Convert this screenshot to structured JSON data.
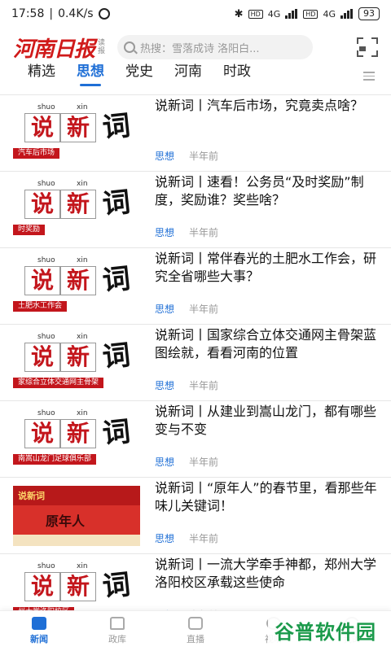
{
  "status": {
    "time": "17:58",
    "speed": "0.4K/s",
    "battery": "93",
    "net1": "4G",
    "net2": "4G",
    "hd": "HD"
  },
  "header": {
    "logo": "河南日报",
    "logo_sub": "读报",
    "search_placeholder": "热搜：雪落成诗 洛阳白..."
  },
  "tabs": [
    "精选",
    "思想",
    "党史",
    "河南",
    "时政"
  ],
  "active_tab": 1,
  "articles": [
    {
      "title": "说新词丨汽车后市场，究竟卖点啥？",
      "category": "思想",
      "time": "半年前",
      "ribbon": "汽车后市场",
      "py1": "shuo",
      "py2": "xin",
      "c1": "说",
      "c2": "新",
      "c3": "词"
    },
    {
      "title": "说新词丨速看！公务员“及时奖励”制度，奖励谁？奖些啥？",
      "category": "思想",
      "time": "半年前",
      "ribbon": "时奖励",
      "py1": "shuo",
      "py2": "xin",
      "c1": "说",
      "c2": "新",
      "c3": "词"
    },
    {
      "title": "说新词丨常伴春光的土肥水工作会，研究全省哪些大事？",
      "category": "思想",
      "time": "半年前",
      "ribbon": "土肥水工作会",
      "py1": "shuo",
      "py2": "xin",
      "c1": "说",
      "c2": "新",
      "c3": "词"
    },
    {
      "title": "说新词丨国家综合立体交通网主骨架蓝图绘就，看看河南的位置",
      "category": "思想",
      "time": "半年前",
      "ribbon": "家综合立体交通网主骨架",
      "py1": "shuo",
      "py2": "xin",
      "c1": "说",
      "c2": "新",
      "c3": "词"
    },
    {
      "title": "说新词丨从建业到嵩山龙门，都有哪些变与不变",
      "category": "思想",
      "time": "半年前",
      "ribbon": "南嵩山龙门足球俱乐部",
      "py1": "shuo",
      "py2": "xin",
      "c1": "说",
      "c2": "新",
      "c3": "词"
    },
    {
      "title": "说新词丨“原年人”的春节里，看那些年味儿关键词！",
      "category": "思想",
      "time": "半年前",
      "cny_title": "原年人",
      "cny_tag": "说新词"
    },
    {
      "title": "说新词丨一流大学牵手神都，郑州大学洛阳校区承载这些使命",
      "category": "思想",
      "time": "半年前",
      "ribbon": "州大学洛阳校区",
      "py1": "shuo",
      "py2": "xin",
      "c1": "说",
      "c2": "新",
      "c3": "词"
    }
  ],
  "bottom_nav": [
    "新闻",
    "政库",
    "直播",
    "视听",
    "我的"
  ],
  "watermark": "谷普软件园",
  "colors": {
    "accent": "#1f6fd6",
    "brand_red": "#d01a1a"
  }
}
